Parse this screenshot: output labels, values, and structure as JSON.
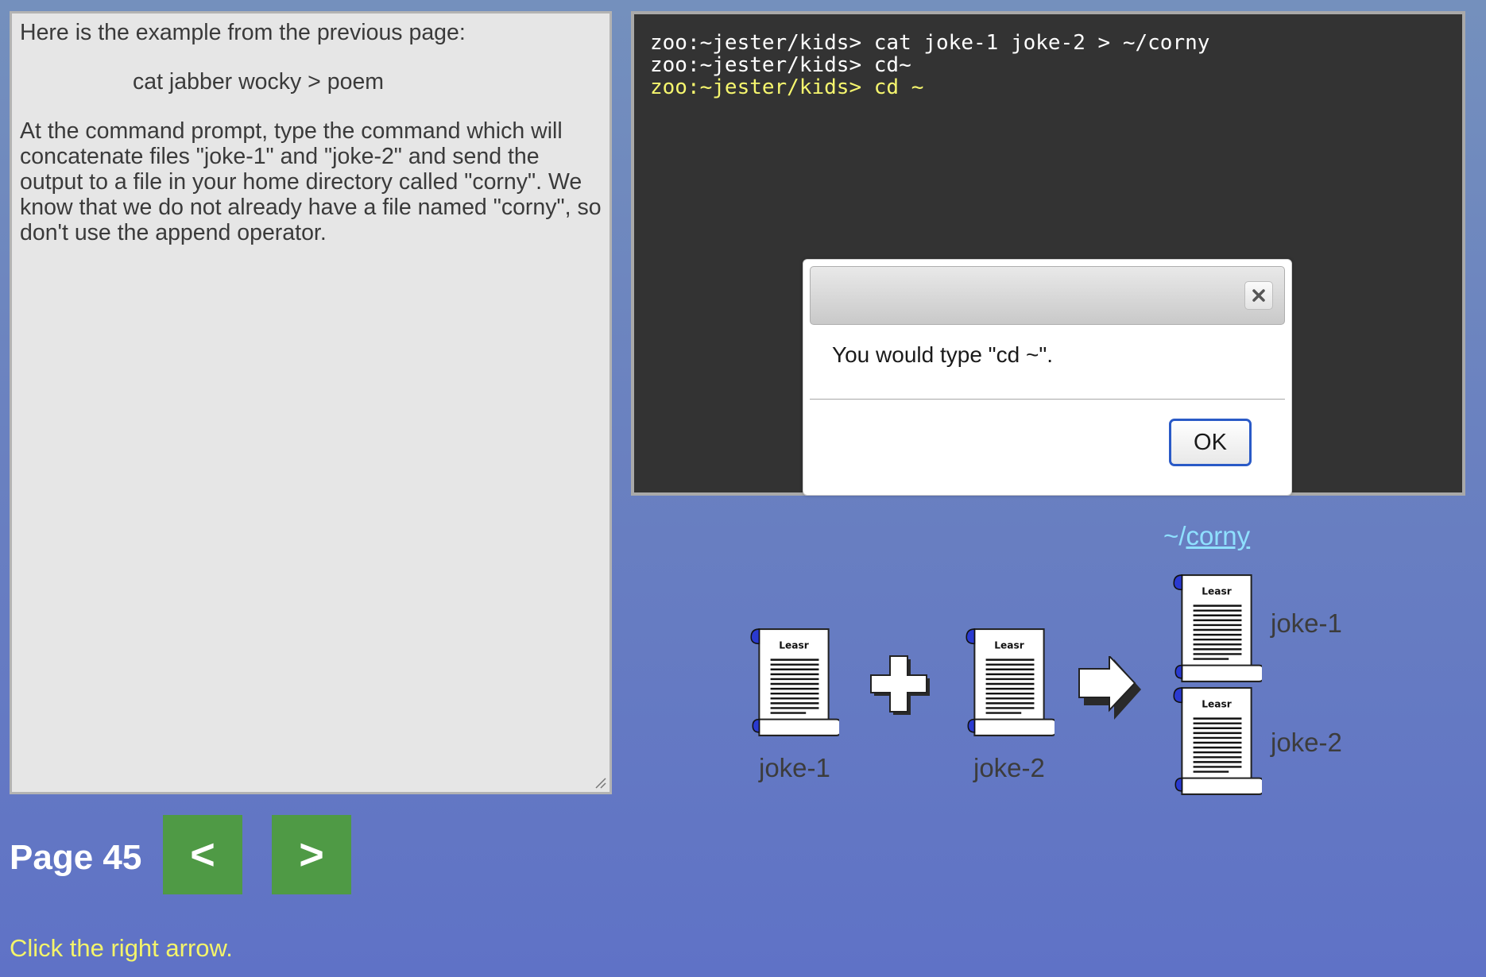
{
  "instructions": {
    "intro": "Here is the example from the previous page:",
    "example_command": "cat jabber wocky > poem",
    "task": "At the command prompt, type the command which will concatenate files \"joke-1\" and \"joke-2\" and send the output to a file in your home directory called \"corny\". We know that we do not already have a file named \"corny\", so don't use the append operator."
  },
  "terminal": {
    "lines": [
      "zoo:~jester/kids> cat joke-1 joke-2 > ~/corny",
      "zoo:~jester/kids> cd~"
    ],
    "current_line": "zoo:~jester/kids> cd ~",
    "current_line_color": "#f6f66e"
  },
  "dialog": {
    "message": "You would type \"cd ~\".",
    "ok_label": "OK",
    "close_icon": "close-icon"
  },
  "diagram": {
    "source_labels": [
      "joke-1",
      "joke-2"
    ],
    "output_link_prefix": "~/",
    "output_link_name": "corny",
    "output_labels": [
      "joke-1",
      "joke-2"
    ],
    "scroll_heading": "Leasr",
    "plus_icon": "plus-icon",
    "arrow_icon": "right-arrow-icon"
  },
  "navigation": {
    "page_label": "Page 45",
    "prev_label": "<",
    "next_label": ">",
    "hint": "Click the right arrow."
  },
  "colors": {
    "nav_button": "#4f9a45",
    "hint_text": "#f4f46a",
    "link": "#8fe0ff"
  }
}
